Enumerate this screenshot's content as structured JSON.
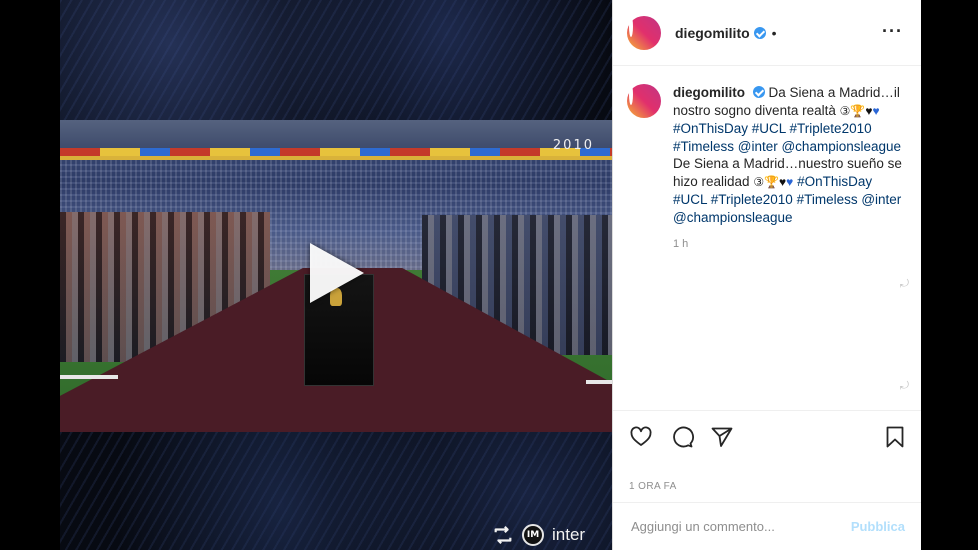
{
  "media": {
    "overlay_year": "2010",
    "repost": {
      "icon": "repost-icon",
      "account": "inter"
    }
  },
  "post": {
    "author": "diegomilito",
    "header_separator": "•",
    "verified": true,
    "caption": {
      "line_it_1": "Da Siena a Madrid…il",
      "line_it_2": "nostro sogno diventa realtà",
      "hashtags_1": "#OnThisDay #UCL #Triplete2010",
      "hashtags_2": "#Timeless @inter @championsleague",
      "line_es_1": "De Siena a Madrid…nuestro sueño se",
      "line_es_2": "hizo realidad",
      "hashtags_3": "#OnThisDay",
      "hashtags_4": "#UCL #Triplete2010 #Timeless @inter",
      "hashtags_5": "@championsleague"
    },
    "caption_time": "1 h",
    "date_label": "1 ORA FA"
  },
  "comment": {
    "placeholder": "Aggiungi un commento...",
    "publish_label": "Pubblica"
  },
  "colors": {
    "verified_blue": "#3897f0",
    "link_blue": "#00376b",
    "publish_disabled": "#b2dffc",
    "carpet": "#4a1c26"
  }
}
